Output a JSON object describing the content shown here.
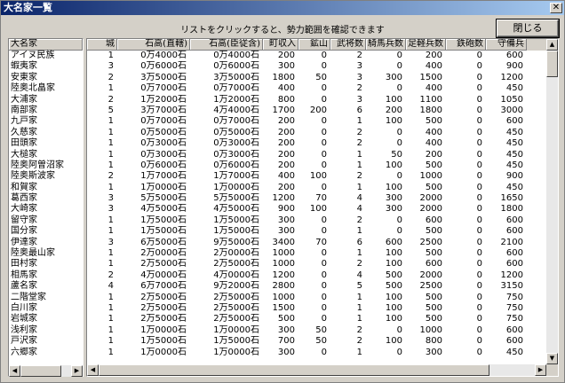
{
  "window": {
    "title": "大名家一覧",
    "close_glyph": "✕"
  },
  "instruction": "リストをクリックすると、勢力範囲を確認できます",
  "close_button": "閉じる",
  "left": {
    "header": "大名家"
  },
  "columns": [
    "城",
    "石高(直轄)",
    "石高(臣従含)",
    "町収入",
    "鉱山",
    "武将数",
    "騎馬兵数",
    "足軽兵数",
    "鉄砲数",
    "守備兵"
  ],
  "rows": [
    {
      "name": "アイヌ民族",
      "v": [
        "1",
        "0万4000石",
        "0万4000石",
        "200",
        "0",
        "2",
        "0",
        "200",
        "0",
        "600"
      ]
    },
    {
      "name": "蝦夷家",
      "v": [
        "3",
        "0万6000石",
        "0万6000石",
        "300",
        "0",
        "3",
        "0",
        "400",
        "0",
        "900"
      ]
    },
    {
      "name": "安東家",
      "v": [
        "2",
        "3万5000石",
        "3万5000石",
        "1800",
        "50",
        "3",
        "300",
        "1500",
        "0",
        "1200"
      ]
    },
    {
      "name": "陸奥北畠家",
      "v": [
        "1",
        "0万7000石",
        "0万7000石",
        "400",
        "0",
        "2",
        "0",
        "400",
        "0",
        "450"
      ]
    },
    {
      "name": "大浦家",
      "v": [
        "2",
        "1万2000石",
        "1万2000石",
        "800",
        "0",
        "3",
        "100",
        "1100",
        "0",
        "1050"
      ]
    },
    {
      "name": "南部家",
      "v": [
        "5",
        "3万7000石",
        "4万4000石",
        "1700",
        "200",
        "6",
        "200",
        "1800",
        "0",
        "3000"
      ]
    },
    {
      "name": "九戸家",
      "v": [
        "1",
        "0万7000石",
        "0万7000石",
        "200",
        "0",
        "1",
        "100",
        "500",
        "0",
        "600"
      ]
    },
    {
      "name": "久慈家",
      "v": [
        "1",
        "0万5000石",
        "0万5000石",
        "200",
        "0",
        "2",
        "0",
        "400",
        "0",
        "450"
      ]
    },
    {
      "name": "田頭家",
      "v": [
        "1",
        "0万3000石",
        "0万3000石",
        "200",
        "0",
        "2",
        "0",
        "400",
        "0",
        "450"
      ]
    },
    {
      "name": "大槌家",
      "v": [
        "1",
        "0万3000石",
        "0万3000石",
        "200",
        "0",
        "1",
        "50",
        "200",
        "0",
        "450"
      ]
    },
    {
      "name": "陸奥阿曽沼家",
      "v": [
        "1",
        "0万6000石",
        "0万6000石",
        "200",
        "0",
        "1",
        "100",
        "500",
        "0",
        "450"
      ]
    },
    {
      "name": "陸奥斯波家",
      "v": [
        "2",
        "1万7000石",
        "1万7000石",
        "400",
        "100",
        "2",
        "0",
        "1000",
        "0",
        "900"
      ]
    },
    {
      "name": "和賀家",
      "v": [
        "1",
        "1万0000石",
        "1万0000石",
        "200",
        "0",
        "1",
        "100",
        "500",
        "0",
        "450"
      ]
    },
    {
      "name": "葛西家",
      "v": [
        "3",
        "5万5000石",
        "5万5000石",
        "1200",
        "70",
        "4",
        "300",
        "2000",
        "0",
        "1650"
      ]
    },
    {
      "name": "大崎家",
      "v": [
        "3",
        "4万5000石",
        "4万5000石",
        "900",
        "100",
        "4",
        "300",
        "2000",
        "0",
        "1800"
      ]
    },
    {
      "name": "留守家",
      "v": [
        "1",
        "1万5000石",
        "1万5000石",
        "300",
        "0",
        "2",
        "0",
        "600",
        "0",
        "600"
      ]
    },
    {
      "name": "国分家",
      "v": [
        "1",
        "1万5000石",
        "1万5000石",
        "300",
        "0",
        "1",
        "0",
        "500",
        "0",
        "600"
      ]
    },
    {
      "name": "伊達家",
      "v": [
        "3",
        "6万5000石",
        "9万5000石",
        "3400",
        "70",
        "6",
        "600",
        "2500",
        "0",
        "2100"
      ]
    },
    {
      "name": "陸奥最山家",
      "v": [
        "1",
        "2万0000石",
        "2万0000石",
        "1000",
        "0",
        "1",
        "100",
        "500",
        "0",
        "600"
      ]
    },
    {
      "name": "田村家",
      "v": [
        "1",
        "2万5000石",
        "2万5000石",
        "1000",
        "0",
        "2",
        "100",
        "600",
        "0",
        "600"
      ]
    },
    {
      "name": "相馬家",
      "v": [
        "2",
        "4万0000石",
        "4万0000石",
        "1200",
        "0",
        "4",
        "500",
        "2000",
        "0",
        "1200"
      ]
    },
    {
      "name": "蘆名家",
      "v": [
        "4",
        "6万7000石",
        "9万2000石",
        "2800",
        "0",
        "5",
        "500",
        "2500",
        "0",
        "3150"
      ]
    },
    {
      "name": "二階堂家",
      "v": [
        "1",
        "2万5000石",
        "2万5000石",
        "1000",
        "0",
        "1",
        "100",
        "500",
        "0",
        "750"
      ]
    },
    {
      "name": "白川家",
      "v": [
        "1",
        "2万5000石",
        "2万5000石",
        "1500",
        "0",
        "1",
        "100",
        "500",
        "0",
        "750"
      ]
    },
    {
      "name": "岩城家",
      "v": [
        "1",
        "2万5000石",
        "2万5000石",
        "500",
        "0",
        "1",
        "100",
        "500",
        "0",
        "750"
      ]
    },
    {
      "name": "浅利家",
      "v": [
        "1",
        "1万0000石",
        "1万0000石",
        "300",
        "50",
        "2",
        "0",
        "1000",
        "0",
        "600"
      ]
    },
    {
      "name": "戸沢家",
      "v": [
        "1",
        "1万5000石",
        "1万5000石",
        "700",
        "50",
        "2",
        "100",
        "800",
        "0",
        "600"
      ]
    },
    {
      "name": "六郷家",
      "v": [
        "1",
        "1万0000石",
        "1万0000石",
        "300",
        "0",
        "1",
        "0",
        "300",
        "0",
        "450"
      ]
    }
  ]
}
